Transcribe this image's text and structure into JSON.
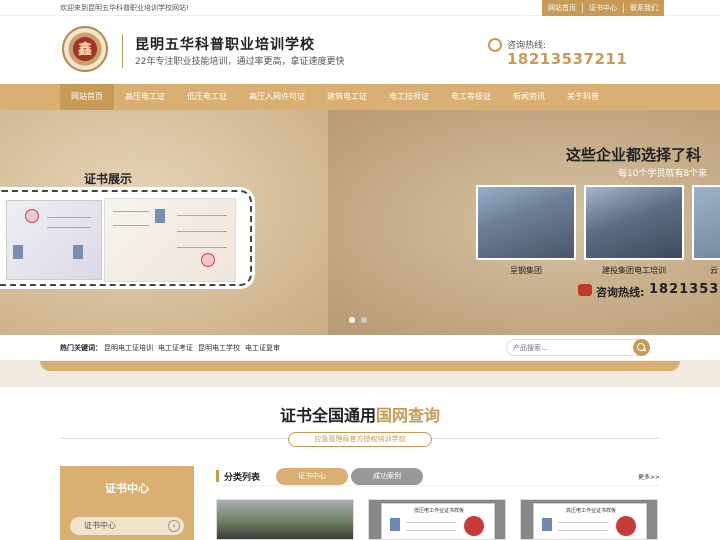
{
  "topbar": {
    "welcome": "欢迎来到昆明五华科普职业培训学校网站!",
    "links": [
      "网站首页",
      "证书中心",
      "联系我们"
    ]
  },
  "header": {
    "logo_text": "鑫",
    "title": "昆明五华科普职业培训学校",
    "subtitle": "22年专注职业技能培训，通过率更高，拿证速度更快",
    "hotline_label": "咨询热线:",
    "hotline_number": "18213537211"
  },
  "nav": {
    "items": [
      "网站首页",
      "高压电工证",
      "低压电工证",
      "高压入网许可证",
      "建筑电工证",
      "电工技师证",
      "电工等级证",
      "新闻资讯",
      "关于科普"
    ],
    "active_index": 0
  },
  "banner": {
    "cert_title": "证书展示",
    "company_heading": "这些企业都选择了科",
    "company_sub": "每10个学员就有8个来",
    "photo_captions": [
      "呈钢集团",
      "建投集团电工培训",
      "云"
    ],
    "phone_label": "咨询热线:",
    "phone_number": "1821353"
  },
  "hot": {
    "label": "热门关键词：",
    "keywords": [
      "昆明电工证培训",
      "电工证考证",
      "昆明电工学校",
      "电工证复审"
    ],
    "search_placeholder": "产品搜索..."
  },
  "section": {
    "title_main": "证书全国通用",
    "title_accent": "国网查询",
    "subtitle": "应急管理局官方授权培训学校"
  },
  "side": {
    "title": "证书中心",
    "item": "证书中心",
    "item_arrow": "›"
  },
  "category": {
    "title": "分类列表",
    "tabs": [
      "证书中心",
      "成功案例"
    ],
    "more": "更多>>"
  },
  "thumbs": {
    "doc_b_title": "低压电工作业证书样板",
    "doc_c_title": "高压电工作业证书样板"
  },
  "colors": {
    "accent": "#c79a55",
    "nav_bg": "#d9b071",
    "hotline": "#c79a55"
  }
}
